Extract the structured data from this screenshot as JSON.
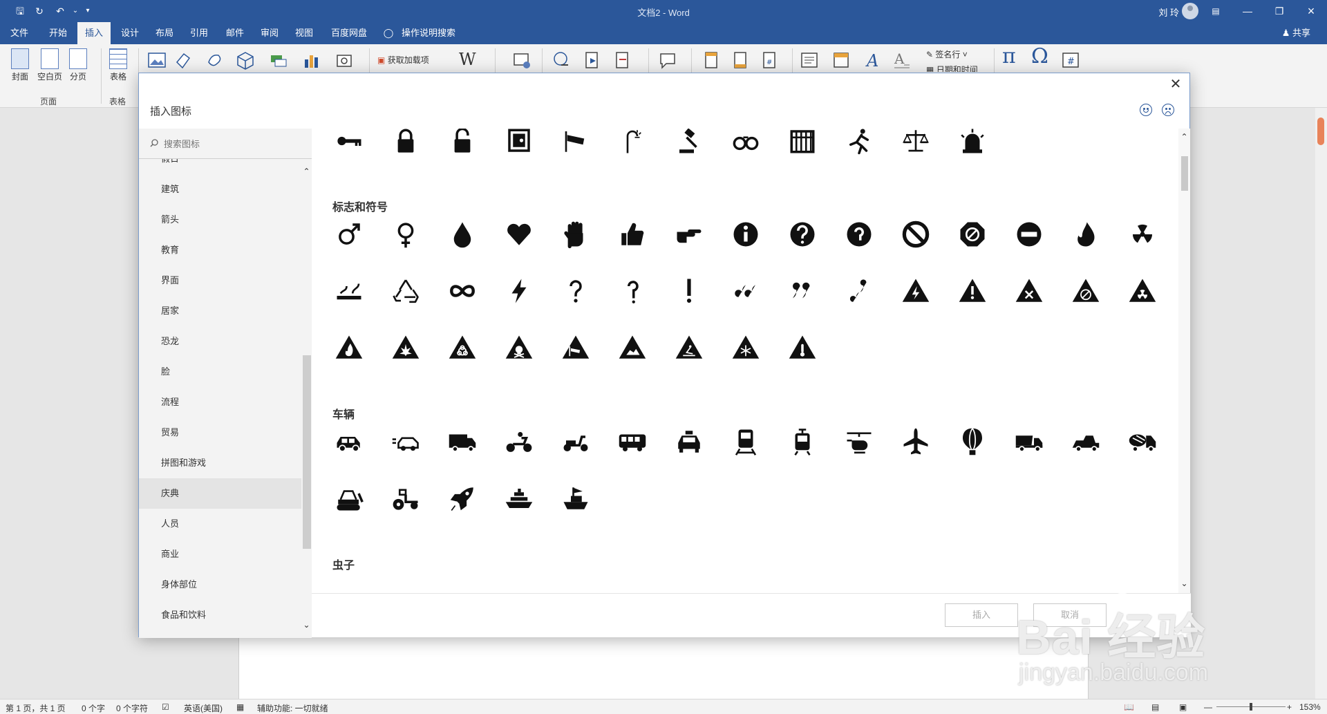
{
  "window": {
    "doc_title": "文档2 - Word",
    "user_name": "刘 玲",
    "share_label": "共享"
  },
  "menu": {
    "tabs": [
      "文件",
      "开始",
      "插入",
      "设计",
      "布局",
      "引用",
      "邮件",
      "审阅",
      "视图",
      "百度网盘",
      "操作说明搜索"
    ],
    "active": "插入"
  },
  "ribbon": {
    "buttons": {
      "cover": "封面",
      "blank": "空白页",
      "break": "分页",
      "table": "表格"
    },
    "groups": {
      "pages": "页面",
      "tables": "表格"
    },
    "get_addins": "获取加载项",
    "signature": "签名行",
    "datetime": "日期和时间"
  },
  "dialog": {
    "title": "插入图标",
    "search_placeholder": "搜索图标",
    "categories": [
      "假日",
      "建筑",
      "箭头",
      "教育",
      "界面",
      "居家",
      "恐龙",
      "脸",
      "流程",
      "贸易",
      "拼图和游戏",
      "庆典",
      "人员",
      "商业",
      "身体部位",
      "食品和饮料"
    ],
    "selected_category": "庆典",
    "sections": {
      "signs": "标志和符号",
      "vehicles": "车辆",
      "insects": "虫子"
    },
    "insert_label": "插入",
    "cancel_label": "取消"
  },
  "status": {
    "page": "第 1 页，共 1 页",
    "words": "0 个字",
    "chars": "0 个字符",
    "language": "英语(美国)",
    "accessibility": "辅助功能: 一切就绪",
    "zoom": "153%"
  },
  "watermark": {
    "brand": "Bai 经验",
    "url": "jingyan.baidu.com"
  },
  "colors": {
    "word_blue": "#2b579a",
    "icon_black": "#111111"
  }
}
